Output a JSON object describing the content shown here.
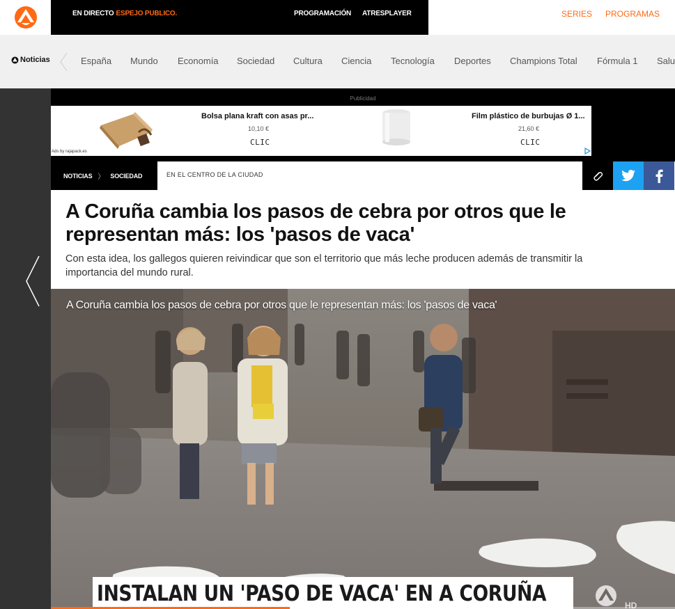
{
  "colors": {
    "accent": "#ff6a13",
    "twitter": "#1da1f2",
    "facebook": "#3b5998"
  },
  "topbar": {
    "live_prefix": "EN DIRECTO",
    "live_channel": "ESPEJO PUBLICO.",
    "nav": [
      "PROGRAMACIÓN",
      "ATRESPLAYER"
    ],
    "right_links": [
      "SERIES",
      "PROGRAMAS"
    ]
  },
  "section_nav": {
    "brand": "Noticias",
    "items": [
      "España",
      "Mundo",
      "Economía",
      "Sociedad",
      "Cultura",
      "Ciencia",
      "Tecnología",
      "Deportes",
      "Champions Total",
      "Fórmula 1",
      "Salud"
    ]
  },
  "ad": {
    "label": "Publicidad",
    "source": "Ads by rajapack.es",
    "items": [
      {
        "title": "Bolsa plana kraft con asas pr...",
        "price": "10,10 €",
        "cta": "CLIC"
      },
      {
        "title": "Film plástico de burbujas Ø 1...",
        "price": "21,60 €",
        "cta": "CLIC"
      }
    ]
  },
  "breadcrumb": {
    "items": [
      "NOTICIAS",
      "SOCIEDAD"
    ],
    "kicker": "EN EL CENTRO DE LA CIUDAD"
  },
  "article": {
    "headline": "A Coruña cambia los pasos de cebra por otros que le representan más: los 'pasos de vaca'",
    "subtitle": "Con esta idea, los gallegos quieren reivindicar que son el territorio que más leche producen además de transmitir la importancia del mundo rural."
  },
  "video": {
    "title": "A Coruña cambia los pasos de cebra por otros que le representan más: los 'pasos de vaca'",
    "lower_third": "INSTALAN UN 'PASO DE VACA' EN A CORUÑA",
    "badge": "HD",
    "progress": 0.39
  }
}
